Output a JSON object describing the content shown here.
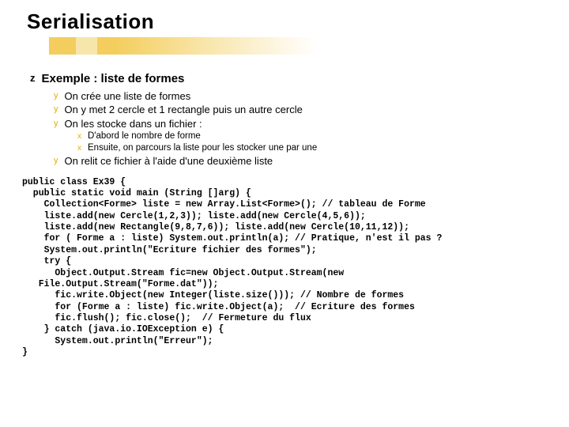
{
  "title": "Serialisation",
  "lvl1": {
    "bullet": "z",
    "text": "Exemple : liste de formes"
  },
  "lvl2": {
    "bullet": "y",
    "items": [
      "On crée une liste de formes",
      "On y met 2 cercle et 1 rectangle puis un autre cercle",
      "On les stocke dans un fichier :"
    ],
    "last": "On relit ce fichier à l'aide d'une deuxième liste"
  },
  "lvl3": {
    "bullet": "x",
    "items": [
      "D'abord le nombre de forme",
      "Ensuite, on parcours la liste pour les stocker une par une"
    ]
  },
  "code": "public class Ex39 {\n  public static void main (String []arg) {\n    Collection<Forme> liste = new Array.List<Forme>(); // tableau de Forme\n    liste.add(new Cercle(1,2,3)); liste.add(new Cercle(4,5,6));\n    liste.add(new Rectangle(9,8,7,6)); liste.add(new Cercle(10,11,12));\n    for ( Forme a : liste) System.out.println(a); // Pratique, n'est il pas ?\n    System.out.println(\"Ecriture fichier des formes\");\n    try {\n      Object.Output.Stream fic=new Object.Output.Stream(new\n   File.Output.Stream(\"Forme.dat\"));\n      fic.write.Object(new Integer(liste.size())); // Nombre de formes\n      for (Forme a : liste) fic.write.Object(a);  // Ecriture des formes\n      fic.flush(); fic.close();  // Fermeture du flux\n    } catch (java.io.IOException e) {\n      System.out.println(\"Erreur\");\n}"
}
